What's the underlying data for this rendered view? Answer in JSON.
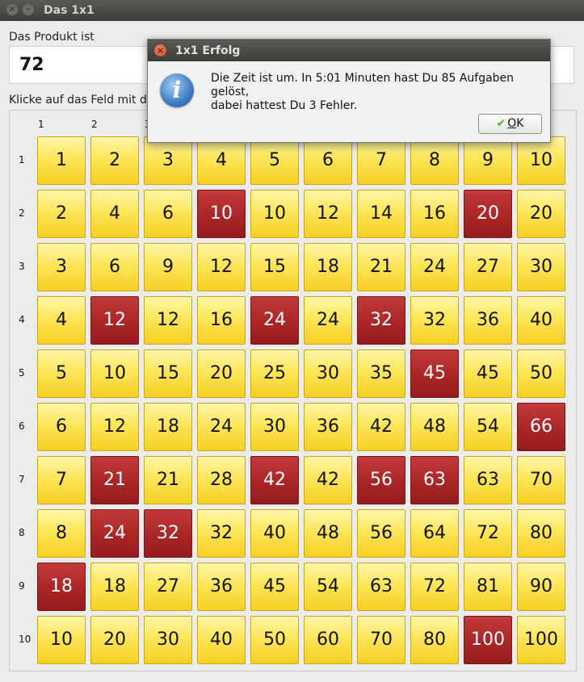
{
  "window": {
    "title": "Das 1x1",
    "close_glyph": "×",
    "minimize_glyph": "–"
  },
  "product": {
    "label": "Das Produkt ist",
    "value": "72"
  },
  "instruction": "Klicke auf das Feld mit de",
  "grid": {
    "col_labels_visible": [
      "1",
      "2",
      "3"
    ],
    "row_labels": [
      "1",
      "2",
      "3",
      "4",
      "5",
      "6",
      "7",
      "8",
      "9",
      "10"
    ],
    "cells": [
      [
        "1",
        "2",
        "3",
        "4",
        "5",
        "6",
        "7",
        "8",
        "9",
        "10"
      ],
      [
        "2",
        "4",
        "6",
        "10",
        "10",
        "12",
        "14",
        "16",
        "20",
        "20"
      ],
      [
        "3",
        "6",
        "9",
        "12",
        "15",
        "18",
        "21",
        "24",
        "27",
        "30"
      ],
      [
        "4",
        "12",
        "12",
        "16",
        "24",
        "24",
        "32",
        "32",
        "36",
        "40"
      ],
      [
        "5",
        "10",
        "15",
        "20",
        "25",
        "30",
        "35",
        "45",
        "45",
        "50"
      ],
      [
        "6",
        "12",
        "18",
        "24",
        "30",
        "36",
        "42",
        "48",
        "54",
        "66"
      ],
      [
        "7",
        "21",
        "21",
        "28",
        "42",
        "42",
        "56",
        "63",
        "63",
        "70"
      ],
      [
        "8",
        "24",
        "32",
        "32",
        "40",
        "48",
        "56",
        "64",
        "72",
        "80"
      ],
      [
        "18",
        "18",
        "27",
        "36",
        "45",
        "54",
        "63",
        "72",
        "81",
        "90"
      ],
      [
        "10",
        "20",
        "30",
        "40",
        "50",
        "60",
        "70",
        "80",
        "100",
        "100"
      ]
    ],
    "wrong_cells": [
      [
        2,
        4
      ],
      [
        2,
        9
      ],
      [
        4,
        2
      ],
      [
        4,
        5
      ],
      [
        4,
        7
      ],
      [
        5,
        8
      ],
      [
        6,
        10
      ],
      [
        7,
        2
      ],
      [
        7,
        5
      ],
      [
        7,
        7
      ],
      [
        7,
        8
      ],
      [
        8,
        2
      ],
      [
        8,
        3
      ],
      [
        9,
        1
      ],
      [
        10,
        9
      ]
    ],
    "colors": {
      "cell_yellow": "#fde65a",
      "cell_red": "#a82424"
    }
  },
  "dialog": {
    "title": "1x1 Erfolg",
    "icon": "info-icon",
    "message_line1": "Die Zeit ist um. In 5:01 Minuten hast Du 85 Aufgaben gelöst,",
    "message_line2": "dabei hattest Du 3 Fehler.",
    "ok_label_first": "O",
    "ok_label_rest": "K",
    "close_glyph": "×"
  }
}
